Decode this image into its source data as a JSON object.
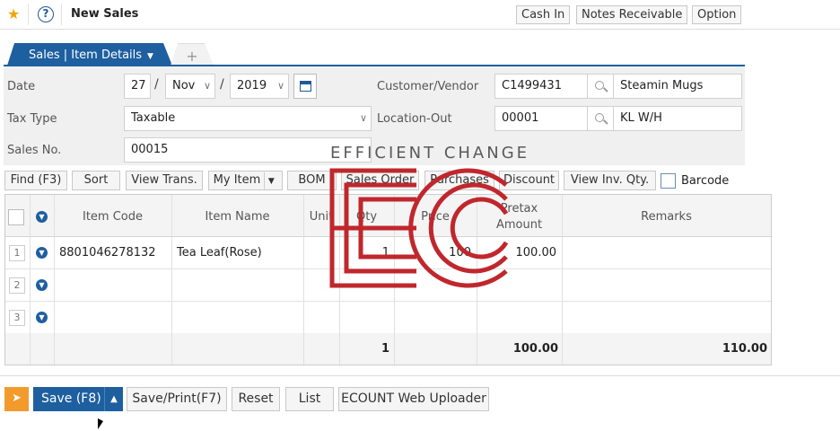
{
  "header": {
    "title": "New Sales",
    "buttons": [
      "Cash In",
      "Notes Receivable",
      "Option"
    ]
  },
  "tabs": {
    "active": "Sales | Item Details",
    "add": "+"
  },
  "form": {
    "date_label": "Date",
    "date_day": "27",
    "date_month": "Nov",
    "date_year": "2019",
    "date_sep": "/",
    "tax_type_label": "Tax Type",
    "tax_type_value": "Taxable",
    "sales_no_label": "Sales No.",
    "sales_no_value": "00015",
    "customer_label": "Customer/Vendor",
    "customer_code": "C1499431",
    "customer_name": "Steamin Mugs",
    "location_label": "Location-Out",
    "location_code": "00001",
    "location_name": "KL W/H"
  },
  "toolbar": {
    "find": "Find (F3)",
    "sort": "Sort",
    "view_trans": "View Trans.",
    "my_item": "My Item",
    "bom": "BOM",
    "sales_order": "Sales Order",
    "purchases": "Purchases",
    "discount": "Discount",
    "view_inv_qty": "View Inv. Qty.",
    "barcode": "Barcode"
  },
  "grid": {
    "headers": {
      "item_code": "Item Code",
      "item_name": "Item Name",
      "unit": "Unit",
      "qty": "Qty",
      "price": "Price",
      "pretax_1": "Pretax",
      "pretax_2": "Amount",
      "remarks": "Remarks"
    },
    "rows": [
      {
        "num": "1",
        "item_code": "8801046278132",
        "item_name": "Tea Leaf(Rose)",
        "qty": "1",
        "price": "100",
        "pretax": "100.00"
      },
      {
        "num": "2"
      },
      {
        "num": "3"
      }
    ],
    "footer": {
      "qty_total": "1",
      "pretax_total": "100.00",
      "remarks_total": "110.00"
    }
  },
  "watermark": {
    "text": "EFFICIENT CHANGE",
    "color": "#c0272d"
  },
  "footer_buttons": {
    "save": "Save (F8)",
    "save_print": "Save/Print(F7)",
    "reset": "Reset",
    "list": "List",
    "uploader": "ECOUNT Web Uploader"
  },
  "colors": {
    "primary": "#1e5fa0",
    "send_button": "#f39a2c",
    "star": "#f0a500"
  }
}
